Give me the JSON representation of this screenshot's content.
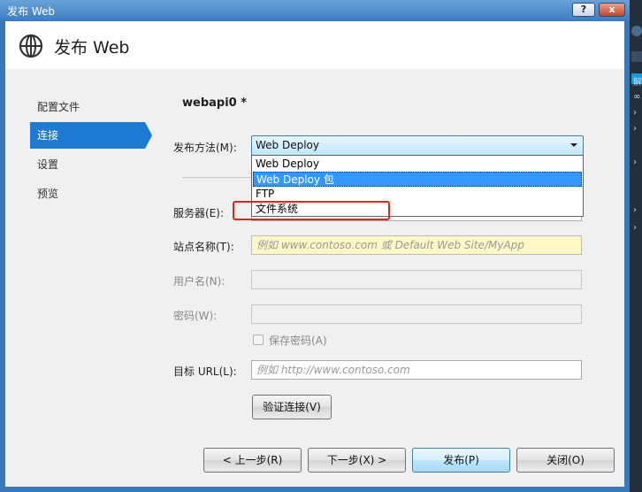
{
  "window": {
    "title": "发布 Web",
    "help_label": "?",
    "close_label": "x"
  },
  "header": {
    "title": "发布 Web",
    "icon": "globe-icon"
  },
  "sidebar": {
    "items": [
      {
        "label": "配置文件",
        "active": false
      },
      {
        "label": "连接",
        "active": true
      },
      {
        "label": "设置",
        "active": false
      },
      {
        "label": "预览",
        "active": false
      }
    ]
  },
  "main": {
    "profile_name": "webapi0 *",
    "publish_method": {
      "label": "发布方法(M):",
      "selected": "Web Deploy",
      "options": [
        "Web Deploy",
        "Web Deploy 包",
        "FTP",
        "文件系统"
      ],
      "highlighted_index": 1
    },
    "server": {
      "label": "服务器(E):"
    },
    "site_name": {
      "label": "站点名称(T):",
      "placeholder": "例如 www.contoso.com 或 Default Web Site/MyApp"
    },
    "username": {
      "label": "用户名(N):"
    },
    "password": {
      "label": "密码(W):"
    },
    "save_password": {
      "label": "保存密码(A)",
      "checked": false
    },
    "target_url": {
      "label": "目标 URL(L):",
      "placeholder": "例如 http://www.contoso.com"
    },
    "validate_button": "验证连接(V)"
  },
  "footer": {
    "prev": "< 上一步(R)",
    "next": "下一步(X) >",
    "publish": "发布(P)",
    "close": "关闭(O)"
  },
  "colors": {
    "accent": "#1c7ad2",
    "highlight": "#3399ff",
    "annotation": "#e32222"
  },
  "background": {
    "marks": [
      "解",
      "∞"
    ]
  }
}
